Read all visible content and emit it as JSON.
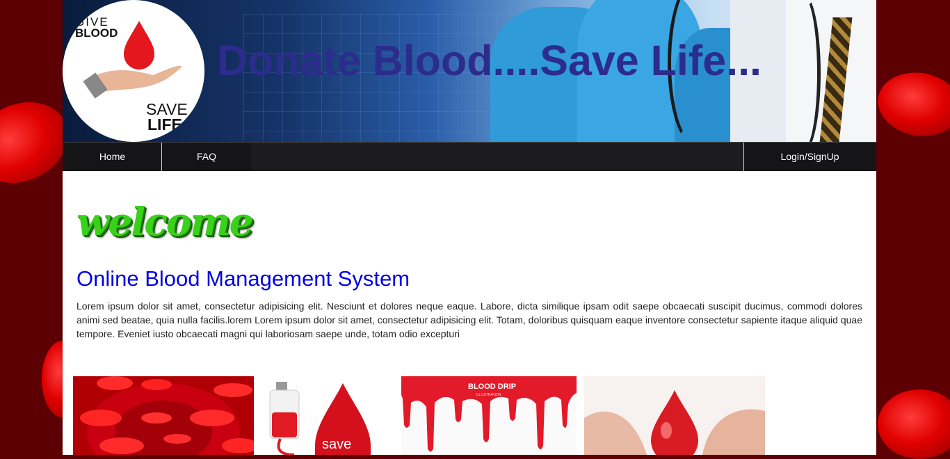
{
  "header": {
    "title": "Donate Blood....Save Life...",
    "logo": {
      "line1": "GIVE",
      "line2": "BLOOD",
      "line3": "SAVE",
      "line4": "LIFE"
    }
  },
  "nav": {
    "home": "Home",
    "faq": "FAQ",
    "login": "Login/SignUp"
  },
  "main": {
    "welcome": "welcome",
    "heading": "Online Blood Management System",
    "intro": "Lorem ipsum dolor sit amet, consectetur adipisicing elit. Nesciunt et dolores neque eaque. Labore, dicta similique ipsam odit saepe obcaecati suscipit ducimus, commodi dolores animi sed beatae, quia nulla facilis.lorem Lorem ipsum dolor sit amet, consectetur adipisicing elit. Totam, doloribus quisquam eaque inventore consectetur sapiente itaque aliquid quae tempore. Eveniet iusto obcaecati magni qui laboriosam saepe unde, totam odio excepturi"
  },
  "gallery": {
    "image2_text": "save",
    "image3_title": "BLOOD DRIP",
    "image3_subtitle": "ILLUSTRATION"
  },
  "colors": {
    "title": "#2c2c8c",
    "heading": "#0000e6",
    "nav_bg": "#1c1c1e",
    "welcome": "#3ad11a",
    "blood_red": "#e00000"
  }
}
